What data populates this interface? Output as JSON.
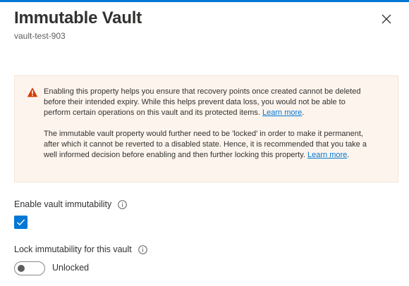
{
  "panel": {
    "title": "Immutable Vault",
    "subtitle": "vault-test-903"
  },
  "icons": {
    "close": "close-icon",
    "warning": "warning-icon",
    "info": "info-icon",
    "checkmark": "checkmark-icon"
  },
  "warning": {
    "paragraph1_text": "Enabling this property helps you ensure that recovery points once created cannot be deleted before their intended expiry. While this helps prevent data loss, you would not be able to perform certain operations on this vault and its protected items.",
    "paragraph1_link": "Learn more",
    "paragraph2_text": "The immutable vault property would further need to be 'locked' in order to make it permanent, after which it cannot be reverted to a disabled state. Hence, it is recommended that you take a well informed decision before enabling and then further locking this property.",
    "paragraph2_link": "Learn more"
  },
  "immutability": {
    "label": "Enable vault immutability",
    "checked": true
  },
  "lock": {
    "label": "Lock immutability for this vault",
    "state": "Unlocked",
    "on": false
  },
  "colors": {
    "accent": "#0078d4",
    "warning_bg": "#fdf4ed",
    "warning_icon": "#d83b01"
  }
}
